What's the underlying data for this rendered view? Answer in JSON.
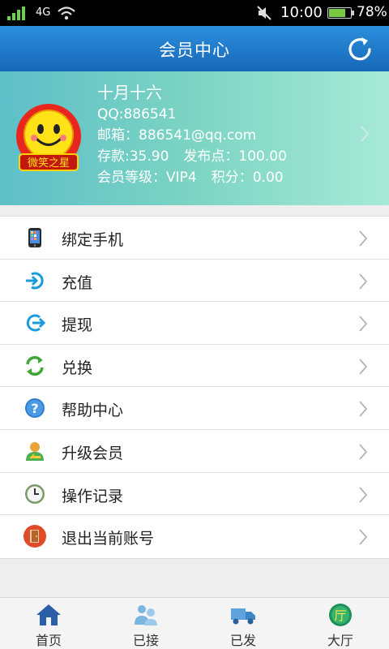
{
  "status_bar": {
    "network": "4G",
    "time": "10:00",
    "battery": "78%",
    "battery_level": 0.78
  },
  "header": {
    "title": "会员中心"
  },
  "profile": {
    "name": "十月十六",
    "qq": "QQ:886541",
    "email": "邮箱：886541@qq.com",
    "deposit": "存款:35.90",
    "publish_points": "发布点：100.00",
    "member_level": "会员等级：VIP4",
    "score": "积分：0.00",
    "avatar_text": "微笑之星"
  },
  "menu": [
    {
      "label": "绑定手机",
      "icon": "phone-icon"
    },
    {
      "label": "充值",
      "icon": "recharge-icon"
    },
    {
      "label": "提现",
      "icon": "withdraw-icon"
    },
    {
      "label": "兑换",
      "icon": "exchange-icon"
    },
    {
      "label": "帮助中心",
      "icon": "help-icon"
    },
    {
      "label": "升级会员",
      "icon": "upgrade-icon"
    },
    {
      "label": "操作记录",
      "icon": "clock-icon"
    },
    {
      "label": "退出当前账号",
      "icon": "logout-icon"
    }
  ],
  "tabs": [
    {
      "label": "首页",
      "icon": "home-icon"
    },
    {
      "label": "已接",
      "icon": "received-icon"
    },
    {
      "label": "已发",
      "icon": "truck-icon"
    },
    {
      "label": "大厅",
      "icon": "hall-icon",
      "icon_text": "厅"
    }
  ],
  "colors": {
    "header": "#1e78c8",
    "profile_from": "#5ebfc9",
    "profile_to": "#a6ead6",
    "accent_blue": "#1a9bdc"
  }
}
